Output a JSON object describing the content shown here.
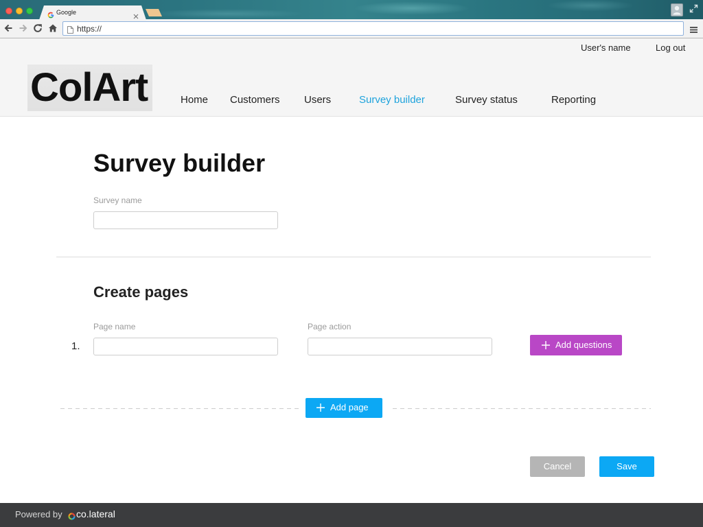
{
  "browser": {
    "tab_title": "Google",
    "url": "https://"
  },
  "header": {
    "user_name": "User's name",
    "logout_label": "Log out",
    "logo_text": "ColArt",
    "nav": [
      {
        "label": "Home",
        "active": false
      },
      {
        "label": "Customers",
        "active": false
      },
      {
        "label": "Users",
        "active": false
      },
      {
        "label": "Survey builder",
        "active": true
      },
      {
        "label": "Survey status",
        "active": false
      },
      {
        "label": "Reporting",
        "active": false
      }
    ]
  },
  "main": {
    "title": "Survey builder",
    "survey_name": {
      "label": "Survey name",
      "value": ""
    },
    "pages_section": {
      "title": "Create pages",
      "page_name_label": "Page name",
      "page_action_label": "Page action",
      "pages": [
        {
          "number": "1.",
          "name_value": "",
          "action_value": ""
        }
      ],
      "add_questions_label": "Add questions",
      "add_page_label": "Add page"
    },
    "actions": {
      "cancel_label": "Cancel",
      "save_label": "Save"
    }
  },
  "footer": {
    "powered_by": "Powered by",
    "brand": "co.lateral"
  },
  "icons": {
    "window_controls": [
      "close-window-icon",
      "minimize-window-icon",
      "maximize-window-icon"
    ],
    "tab_favicon": "google-g-icon",
    "tab_close": "close-icon",
    "new_tab": "new-tab-icon",
    "profile": "user-profile-icon",
    "fullscreen": "expand-icon",
    "navigation": [
      "back-arrow-icon",
      "forward-arrow-icon",
      "reload-icon",
      "home-icon"
    ],
    "address_bar": "page-icon",
    "browser_menu": "menu-icon",
    "add_questions": "plus-icon",
    "add_page": "plus-icon",
    "footer_brand": "colateral-logo-icon"
  },
  "colors": {
    "nav_active": "#1ea3dc",
    "primary_button": "#0ca8f4",
    "add_questions_button": "#b947c6",
    "cancel_button": "#b5b5b5",
    "footer_background": "#3b3c3e",
    "header_background": "#f5f5f5"
  }
}
